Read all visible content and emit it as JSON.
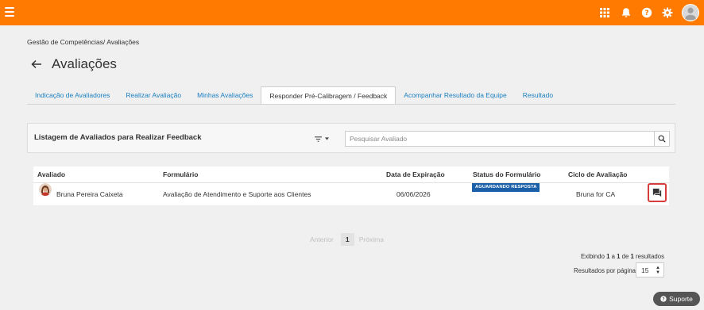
{
  "topbar": {
    "accent_color": "#ff7a00",
    "icons": [
      "menu-icon",
      "apps-grid-icon",
      "bell-icon",
      "help-icon",
      "gear-icon",
      "user-avatar"
    ]
  },
  "breadcrumb": {
    "items": [
      "Gestão de Competências",
      "Avaliações"
    ],
    "separator": "/"
  },
  "page": {
    "title": "Avaliações"
  },
  "tabs": [
    {
      "label": "Indicação de Avaliadores",
      "active": false
    },
    {
      "label": "Realizar Avaliação",
      "active": false
    },
    {
      "label": "Minhas Avaliações",
      "active": false
    },
    {
      "label": "Responder Pré-Calibragem / Feedback",
      "active": true
    },
    {
      "label": "Acompanhar Resultado da Equipe",
      "active": false
    },
    {
      "label": "Resultado",
      "active": false
    }
  ],
  "listing": {
    "title": "Listagem de Avaliados para Realizar Feedback",
    "search_placeholder": "Pesquisar Avaliado"
  },
  "table": {
    "columns": [
      "Avaliado",
      "Formulário",
      "Data de Expiração",
      "Status do Formulário",
      "Ciclo de Avaliação"
    ],
    "rows": [
      {
        "avaliado": "Bruna Pereira Caixeta",
        "formulario": "Avaliação de Atendimento e Suporte aos Clientes",
        "data_expiracao": "06/06/2026",
        "status": "AGUARDANDO RESPOSTA",
        "ciclo": "Bruna for CA"
      }
    ]
  },
  "pagination": {
    "prev": "Anterior",
    "current": "1",
    "next": "Próxima"
  },
  "results": {
    "prefix": "Exibindo",
    "from": "1",
    "mid": "a",
    "to": "1",
    "of": "de",
    "total": "1",
    "suffix": "resultados",
    "per_page_label": "Resultados por página",
    "per_page_value": "15"
  },
  "support": {
    "label": "Suporte"
  },
  "colors": {
    "status_badge": "#1a5fa8",
    "feedback_highlight": "#d63d3d",
    "link": "#1a7fc1"
  }
}
